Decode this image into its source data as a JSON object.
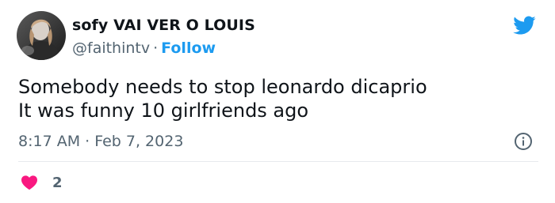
{
  "tweet": {
    "author": {
      "display_name": "sofy VAI VER O LOUIS",
      "handle": "@faithintv",
      "separator": "·",
      "follow_label": "Follow"
    },
    "text_lines": [
      "Somebody needs to stop leonardo dicaprio",
      "It was funny 10 girlfriends ago"
    ],
    "timestamp": "8:17 AM · Feb 7, 2023",
    "likes_count": "2",
    "icons": {
      "brand": "twitter-bird-icon",
      "info": "info-icon",
      "like": "heart-icon"
    },
    "colors": {
      "accent": "#1d9bf0",
      "secondary_text": "#536471",
      "like": "#f91880",
      "text": "#0f1419"
    }
  }
}
